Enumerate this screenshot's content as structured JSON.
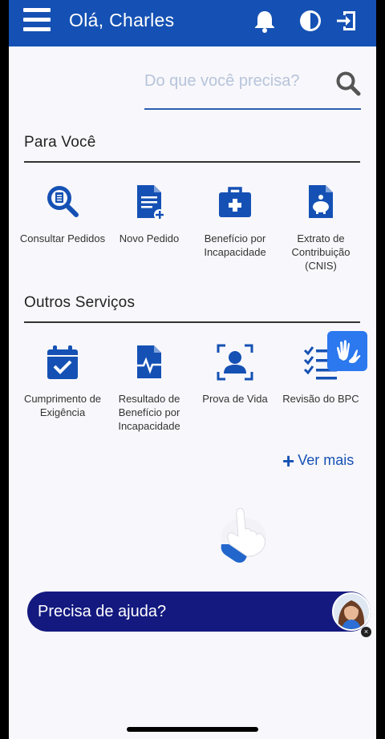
{
  "header": {
    "greeting": "Olá, Charles",
    "icons": [
      "menu-icon",
      "bell-icon",
      "contrast-icon",
      "logout-icon"
    ],
    "color": "#1551b4"
  },
  "search": {
    "placeholder": "Do que você precisa?"
  },
  "sections": {
    "para_voce": {
      "title": "Para Você",
      "items": [
        {
          "label": "Consultar Pedidos",
          "icon": "search-document-icon"
        },
        {
          "label": "Novo Pedido",
          "icon": "new-document-icon"
        },
        {
          "label": "Benefício por Incapacidade",
          "icon": "medical-kit-icon"
        },
        {
          "label": "Extrato de Contribuição (CNIS)",
          "icon": "piggy-bank-document-icon"
        }
      ]
    },
    "outros": {
      "title": "Outros Serviços",
      "items": [
        {
          "label": "Cumprimento de Exigência",
          "icon": "calendar-check-icon"
        },
        {
          "label": "Resultado de Benefício por Incapacidade",
          "icon": "heartbeat-document-icon"
        },
        {
          "label": "Prova de Vida",
          "icon": "face-scan-icon"
        },
        {
          "label": "Revisão do BPC",
          "icon": "checklist-icon"
        }
      ]
    }
  },
  "ver_mais": "Ver mais",
  "help": {
    "text": "Precisa de ajuda?",
    "close": "×"
  },
  "colors": {
    "accent": "#1551b4",
    "help_bg": "#13197f",
    "libras": "#2b78ef"
  }
}
